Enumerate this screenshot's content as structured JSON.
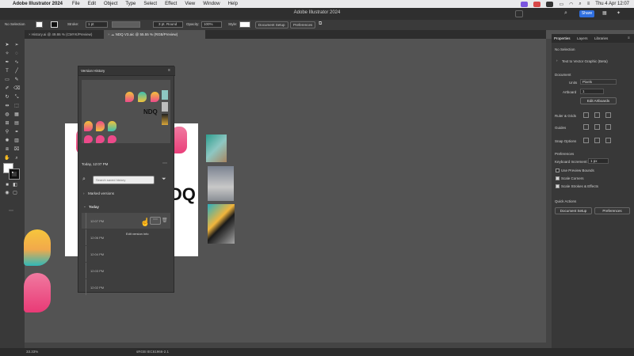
{
  "menubar": {
    "app_name": "Adobe Illustrator 2024",
    "items": [
      "File",
      "Edit",
      "Object",
      "Type",
      "Select",
      "Effect",
      "View",
      "Window",
      "Help"
    ],
    "clock": "Thu 4 Apr  12:07"
  },
  "window": {
    "title": "Adobe Illustrator 2024",
    "share_label": "Share"
  },
  "controlbar": {
    "selection": "No Selection",
    "stroke_label": "Stroke:",
    "stroke_value": "1 pt",
    "brush_value": "3 pt. Round",
    "opacity_label": "Opacity:",
    "opacity_value": "100%",
    "style_label": "Style:",
    "document_setup": "Document Setup",
    "preferences": "Preferences"
  },
  "tabs": [
    {
      "label": "History.ai @ 49.86 % (CMYK/Preview)",
      "active": false
    },
    {
      "label": "NDQ V3.aic @ 55.55 % (RGB/Preview)",
      "active": true
    }
  ],
  "canvas": {
    "ndq_text": "NDQ"
  },
  "version_history": {
    "title": "Version History",
    "current": "Today, 12:07 PM",
    "search_placeholder": "Search saved history",
    "marked_versions": "Marked versions",
    "today": "Today",
    "tooltip": "Edit version info",
    "versions": [
      "12:07 PM",
      "12:06 PM",
      "12:04 PM",
      "12:03 PM",
      "12:02 PM"
    ]
  },
  "properties": {
    "tabs": [
      "Properties",
      "Layers",
      "Libraries"
    ],
    "no_selection": "No Selection",
    "text_to_vector": "Text to Vector Graphic (Beta)",
    "document": "Document",
    "units_label": "Units",
    "units_value": "Pixels",
    "artboard_label": "Artboard",
    "artboard_value": "1",
    "edit_artboards": "Edit Artboards",
    "ruler_grids": "Ruler & Grids",
    "guides": "Guides",
    "snap_options": "Snap Options",
    "preferences": "Preferences",
    "keyboard_increment_label": "Keyboard Increment:",
    "keyboard_increment_value": "1 px",
    "use_preview_bounds": "Use Preview Bounds",
    "scale_corners": "Scale Corners",
    "scale_strokes": "Scale Strokes & Effects",
    "quick_actions": "Quick Actions",
    "document_setup": "Document Setup",
    "preferences_btn": "Preferences"
  },
  "status": {
    "zoom": "33.33%",
    "color_profile": "sRGB IEC61966-2.1"
  },
  "colors": {
    "accent": "#2f6fe0",
    "pin_yellow": "#f2c23a",
    "pin_pink": "#ec4a8a",
    "pin_teal": "#3cc0b0"
  }
}
